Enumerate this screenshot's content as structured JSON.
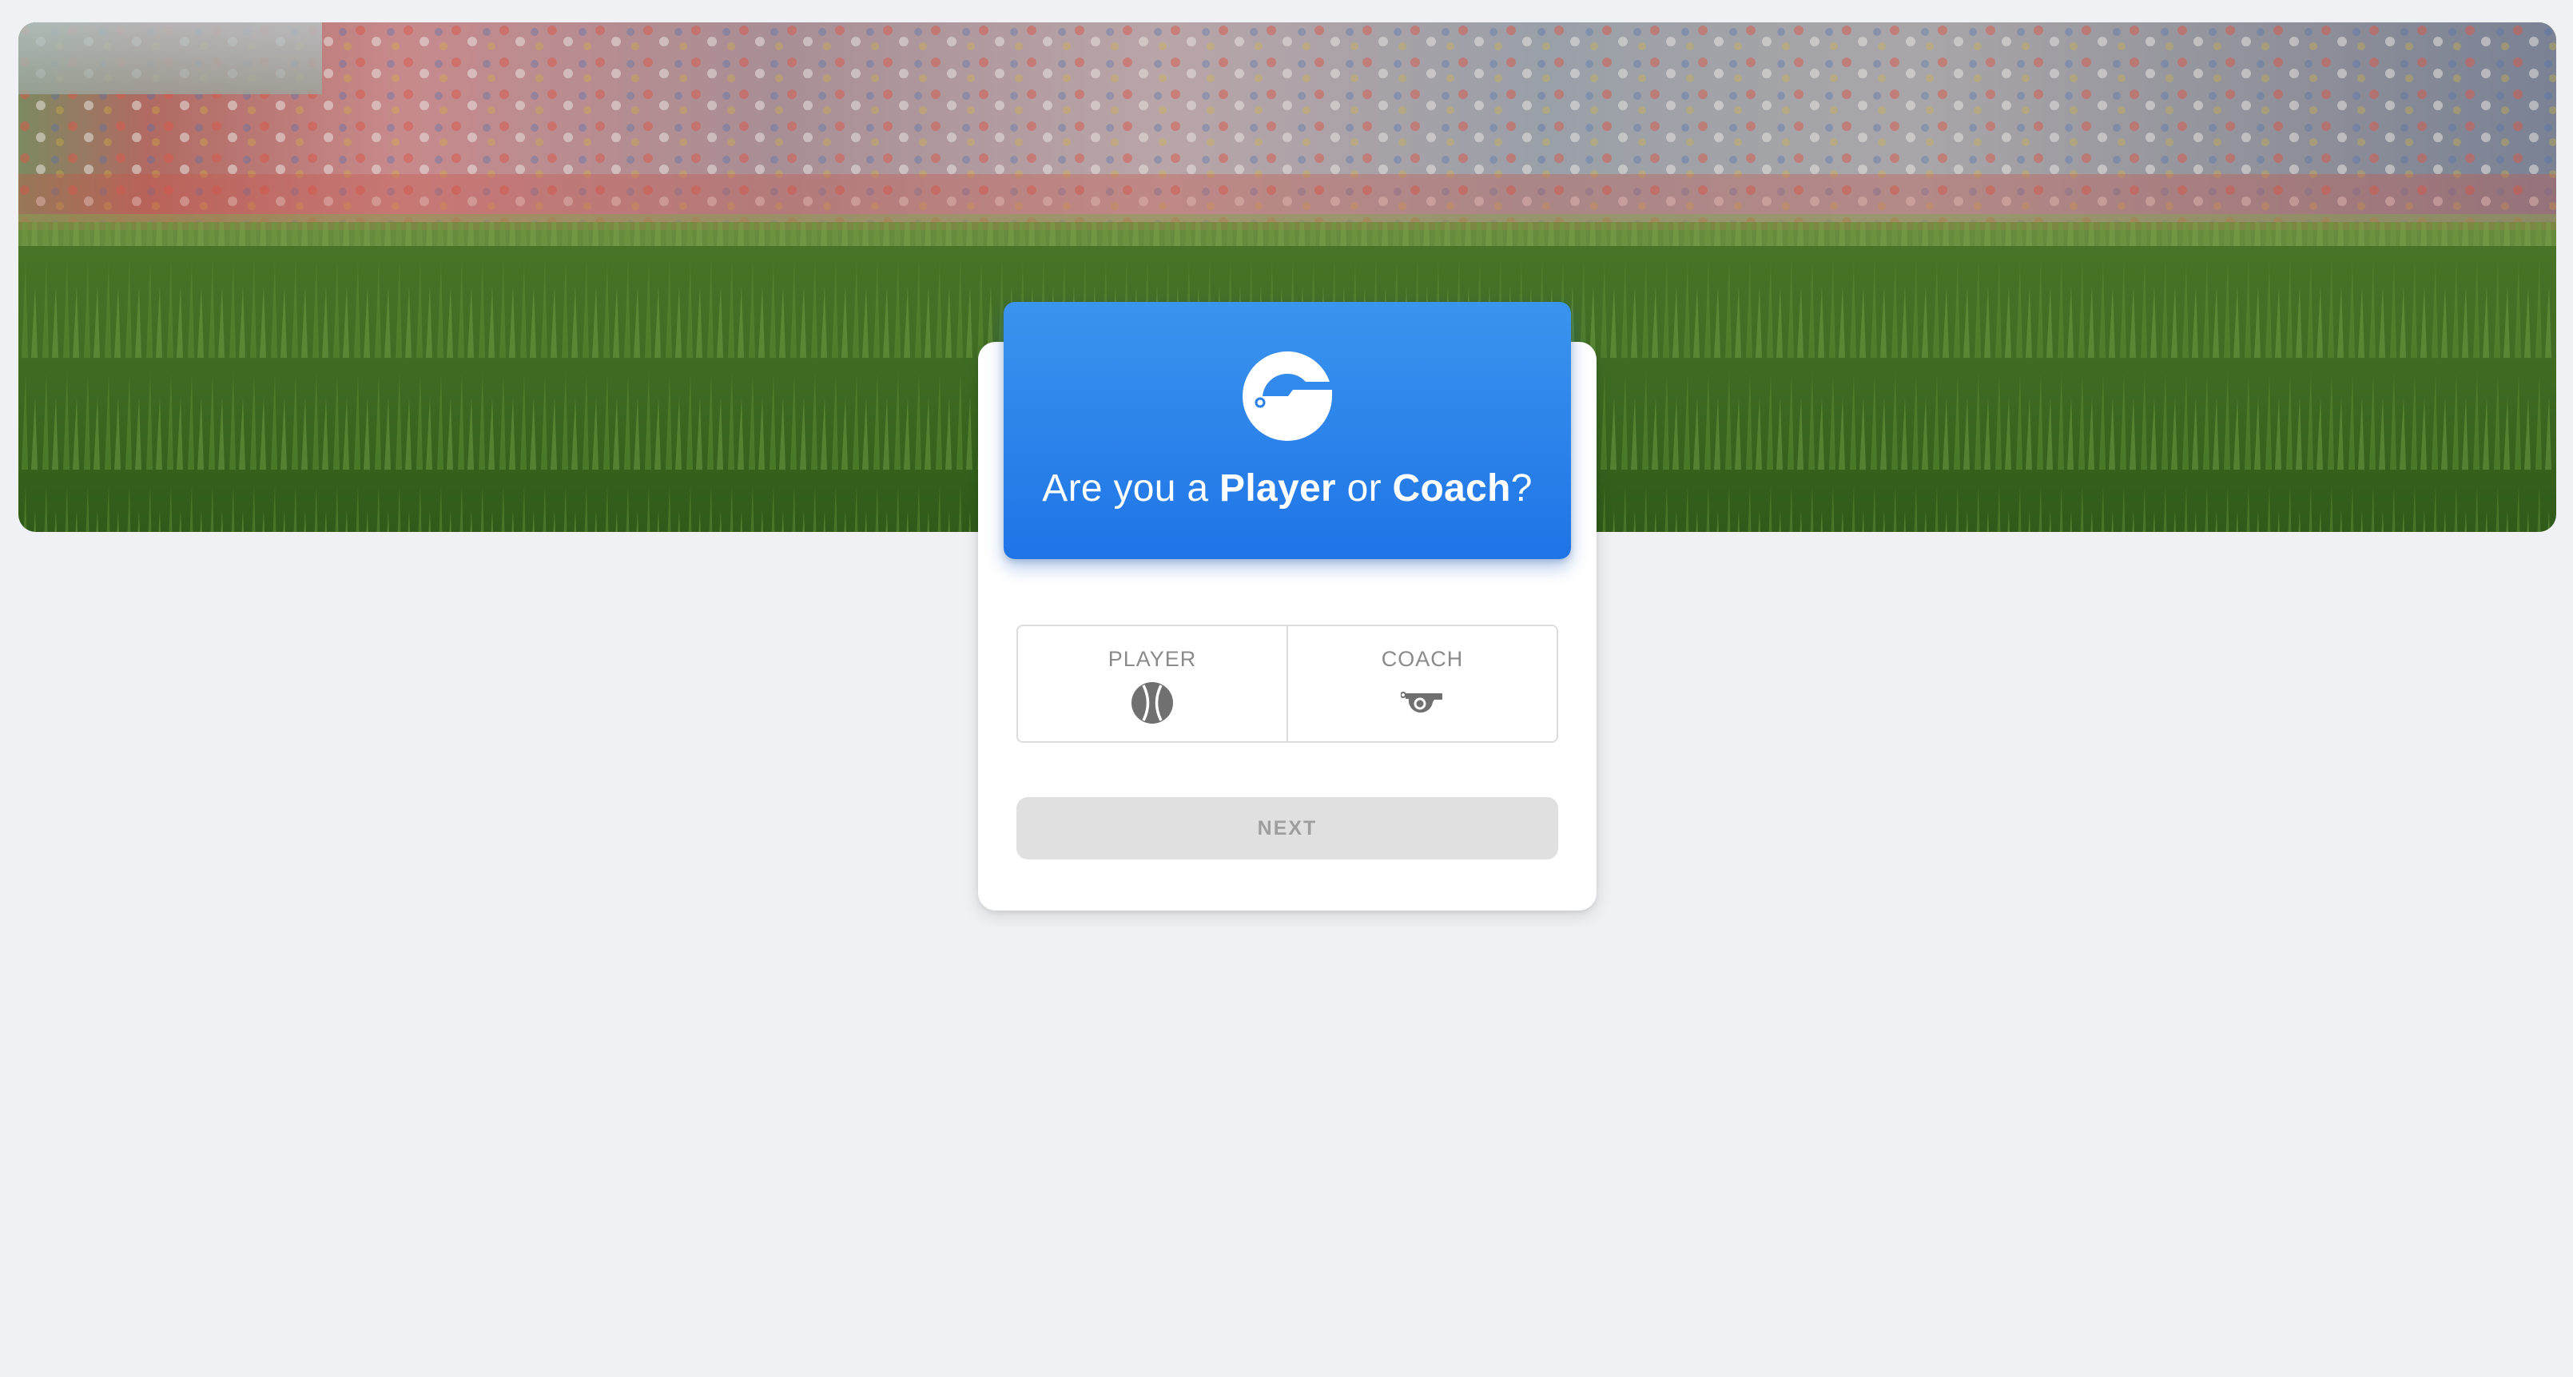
{
  "header": {
    "headline_prefix": "Are you a ",
    "headline_player": "Player",
    "headline_middle": " or ",
    "headline_coach": "Coach",
    "headline_suffix": "?"
  },
  "options": [
    {
      "label": "PLAYER",
      "icon": "ball-icon"
    },
    {
      "label": "COACH",
      "icon": "whistle-icon"
    }
  ],
  "next_button": {
    "label": "NEXT",
    "state": "disabled"
  },
  "colors": {
    "accent_top": "#3b94ee",
    "accent_bottom": "#1f74e6",
    "page_bg": "#f0f1f5",
    "disabled_bg": "#e0e0e0",
    "disabled_text": "#9e9e9e",
    "icon_gray": "#707070"
  }
}
